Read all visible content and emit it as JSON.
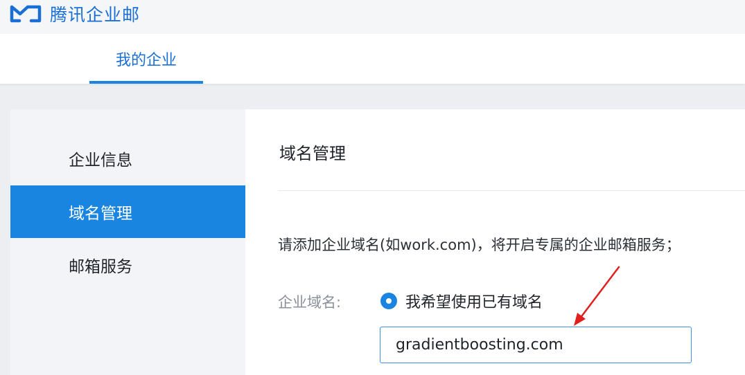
{
  "app": {
    "brand_name": "腾讯企业邮",
    "brand_color": "#1a6fd4",
    "accent_color": "#1a85e0",
    "logo_icon": "tencent-exmail-logo-icon"
  },
  "nav": {
    "active_tab": "我的企业"
  },
  "sidebar": {
    "items": [
      {
        "label": "企业信息",
        "active": false
      },
      {
        "label": "域名管理",
        "active": true
      },
      {
        "label": "邮箱服务",
        "active": false
      }
    ]
  },
  "main": {
    "title": "域名管理",
    "description": "请添加企业域名(如work.com)，将开启专属的企业邮箱服务；",
    "field_label": "企业域名:",
    "radio_option": "我希望使用已有域名",
    "radio_selected": true,
    "domain_value": "gradientboosting.com"
  },
  "annotation": {
    "arrow_color": "#e0201c"
  }
}
